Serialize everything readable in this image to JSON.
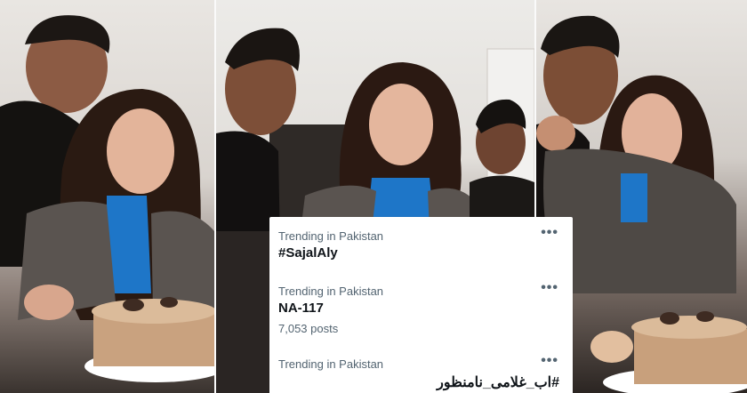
{
  "trends": [
    {
      "context": "Trending in Pakistan",
      "name": "#SajalAly",
      "more": "•••"
    },
    {
      "context": "Trending in Pakistan",
      "name": "NA-117",
      "count": "7,053 posts",
      "more": "•••"
    },
    {
      "context": "Trending in Pakistan",
      "name": "#اب_غلامی_نامنظور",
      "more": "•••"
    }
  ]
}
